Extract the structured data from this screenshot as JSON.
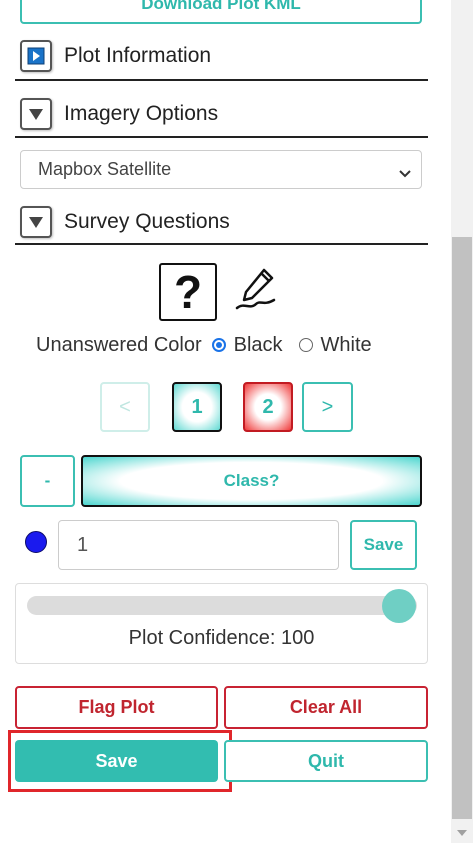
{
  "download_button": "Download Plot KML",
  "sections": {
    "plot_information": "Plot Information",
    "imagery_options": "Imagery Options",
    "survey_questions": "Survey Questions"
  },
  "imagery_select": {
    "selected": "Mapbox Satellite"
  },
  "unanswered_color": {
    "label": "Unanswered Color",
    "options": [
      "Black",
      "White"
    ],
    "selected": "Black"
  },
  "pagination": {
    "prev": "<",
    "pages": [
      "1",
      "2"
    ],
    "next": ">"
  },
  "question": {
    "minus_label": "-",
    "question_label": "Class?"
  },
  "answer": {
    "value": "1",
    "save_label": "Save",
    "color": "#1a1aee"
  },
  "confidence": {
    "label": "Plot Confidence: 100",
    "value": 100
  },
  "actions": {
    "flag_plot": "Flag Plot",
    "clear_all": "Clear All",
    "save": "Save",
    "quit": "Quit"
  },
  "colors": {
    "accent": "#3bbfb2",
    "danger": "#c82333",
    "highlight": "#e0262b"
  }
}
